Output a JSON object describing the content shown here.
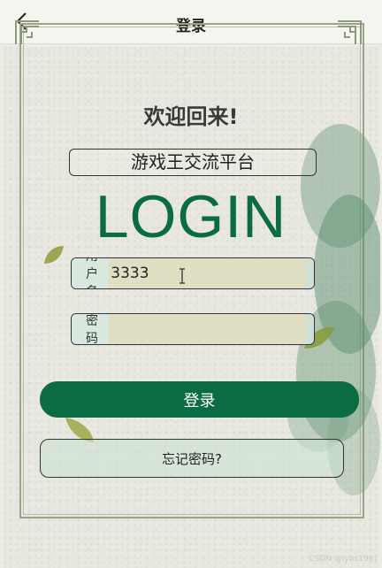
{
  "header": {
    "back_icon": "chevron-left-icon",
    "title": "登录"
  },
  "main": {
    "welcome": "欢迎回来!",
    "platform_name": "游戏王交流平台",
    "login_word": "LOGIN",
    "username": {
      "label": "用户名",
      "value": "3333"
    },
    "password": {
      "label": "密码",
      "value": ""
    },
    "login_button": "登录",
    "forgot_button": "忘记密码?"
  },
  "watermark": "CSDN @lybs1991",
  "colors": {
    "brand": "#0b6b43",
    "input_bg": "#e1dfc3",
    "label_bg": "#d9e8df"
  }
}
